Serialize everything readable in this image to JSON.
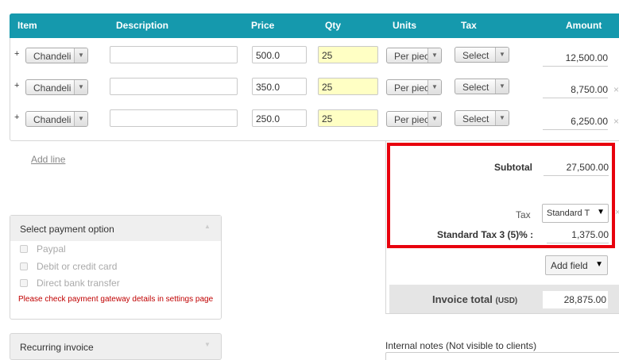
{
  "table": {
    "headers": {
      "item": "Item",
      "description": "Description",
      "price": "Price",
      "qty": "Qty",
      "units": "Units",
      "tax": "Tax",
      "amount": "Amount"
    },
    "rows": [
      {
        "expand": "+",
        "item": "Chandeli",
        "description": "",
        "price": "500.0",
        "qty": "25",
        "units": "Per piec",
        "tax": "Select",
        "amount": "12,500.00",
        "remove": ""
      },
      {
        "expand": "+",
        "item": "Chandeli",
        "description": "",
        "price": "350.0",
        "qty": "25",
        "units": "Per piec",
        "tax": "Select",
        "amount": "8,750.00",
        "remove": "×"
      },
      {
        "expand": "+",
        "item": "Chandeli",
        "description": "",
        "price": "250.0",
        "qty": "25",
        "units": "Per piec",
        "tax": "Select",
        "amount": "6,250.00",
        "remove": "×"
      }
    ],
    "add_line": "Add line"
  },
  "totals": {
    "subtotal_label": "Subtotal",
    "subtotal_value": "27,500.00",
    "tax_label": "Tax",
    "tax_select": "Standard T",
    "tax_remove": "×",
    "standard_tax_label": "Standard Tax 3 (5)% :",
    "standard_tax_value": "1,375.00",
    "add_field": "Add field",
    "invoice_total_label": "Invoice total",
    "invoice_total_currency": "(USD)",
    "invoice_total_value": "28,875.00"
  },
  "payment": {
    "title": "Select payment option",
    "options": [
      "Paypal",
      "Debit or credit card",
      "Direct bank transfer"
    ],
    "warning": "Please check payment gateway details in settings page"
  },
  "recurring": {
    "title": "Recurring invoice"
  },
  "notes": {
    "label": "Internal notes (Not visible to clients)"
  },
  "icons": {
    "dropdown": "▼",
    "collapse": "▲"
  }
}
